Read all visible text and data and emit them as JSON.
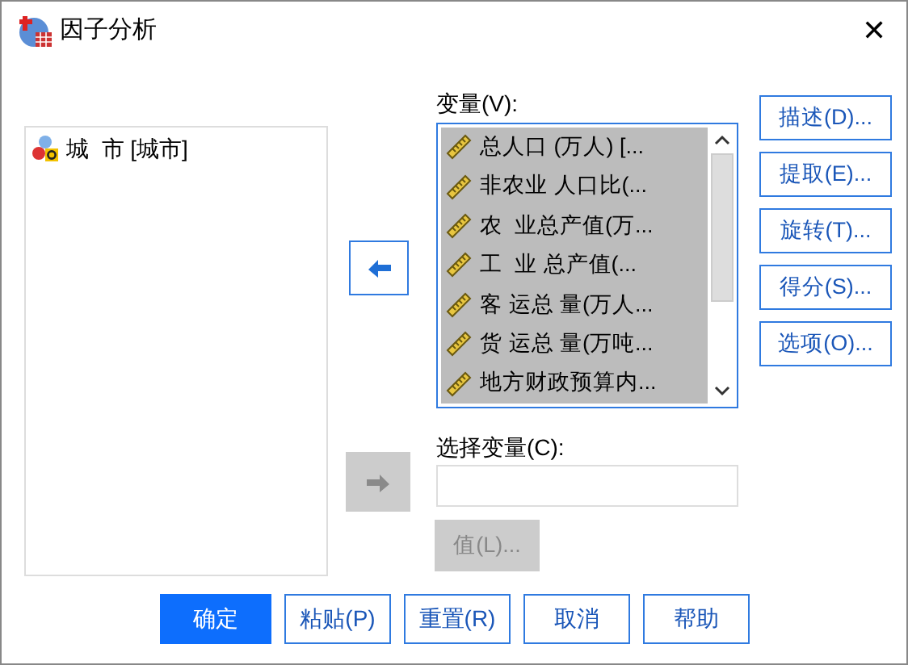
{
  "window": {
    "title": "因子分析",
    "close": "✕"
  },
  "source_list": {
    "items": [
      {
        "label": "城  市 [城市]",
        "selected": false
      }
    ]
  },
  "variables": {
    "label": "变量(V):",
    "items": [
      {
        "label": "总人口 (万人) [...",
        "selected": true
      },
      {
        "label": "非农业 人口比(...",
        "selected": true
      },
      {
        "label": "农  业总产值(万...",
        "selected": true
      },
      {
        "label": "工  业 总产值(...",
        "selected": true
      },
      {
        "label": "客 运总 量(万人...",
        "selected": true
      },
      {
        "label": "货 运总 量(万吨...",
        "selected": true
      },
      {
        "label": "地方财政预算内...",
        "selected": true
      }
    ]
  },
  "side_buttons": [
    "描述(D)...",
    "提取(E)...",
    "旋转(T)...",
    "得分(S)...",
    "选项(O)..."
  ],
  "selection_variable": {
    "label": "选择变量(C):",
    "value_button": {
      "label": "值(L)...",
      "disabled": true
    },
    "arrow_disabled": true
  },
  "main_arrow_disabled": false,
  "buttons": [
    {
      "label": "确定",
      "primary": true
    },
    {
      "label": "粘贴(P)",
      "primary": false
    },
    {
      "label": "重置(R)",
      "primary": false
    },
    {
      "label": "取消",
      "primary": false
    },
    {
      "label": "帮助",
      "primary": false
    }
  ]
}
